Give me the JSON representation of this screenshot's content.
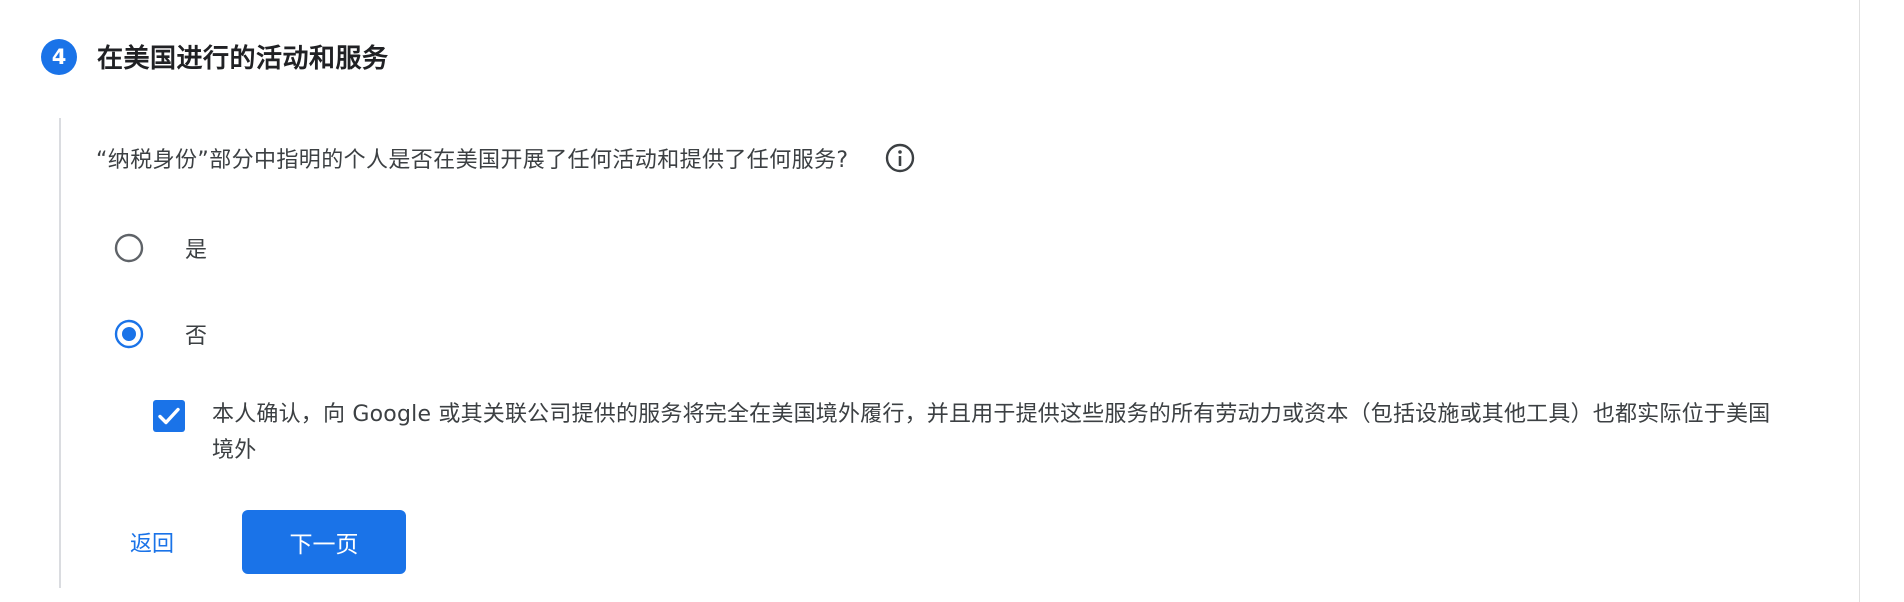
{
  "step": {
    "number": "4",
    "title": "在美国进行的活动和服务"
  },
  "question": {
    "text": "“纳税身份”部分中指明的个人是否在美国开展了任何活动和提供了任何服务?",
    "info_icon": "info-circle-icon"
  },
  "options": [
    {
      "label": "是",
      "selected": false
    },
    {
      "label": "否",
      "selected": true
    }
  ],
  "confirmation": {
    "checked": true,
    "text": "本人确认，向 Google 或其关联公司提供的服务将完全在美国境外履行，并且用于提供这些服务的所有劳动力或资本（包括设施或其他工具）也都实际位于美国境外"
  },
  "actions": {
    "back_label": "返回",
    "next_label": "下一页"
  },
  "colors": {
    "accent": "#1a73e8",
    "text": "#3c4043",
    "divider": "#dadce0"
  }
}
